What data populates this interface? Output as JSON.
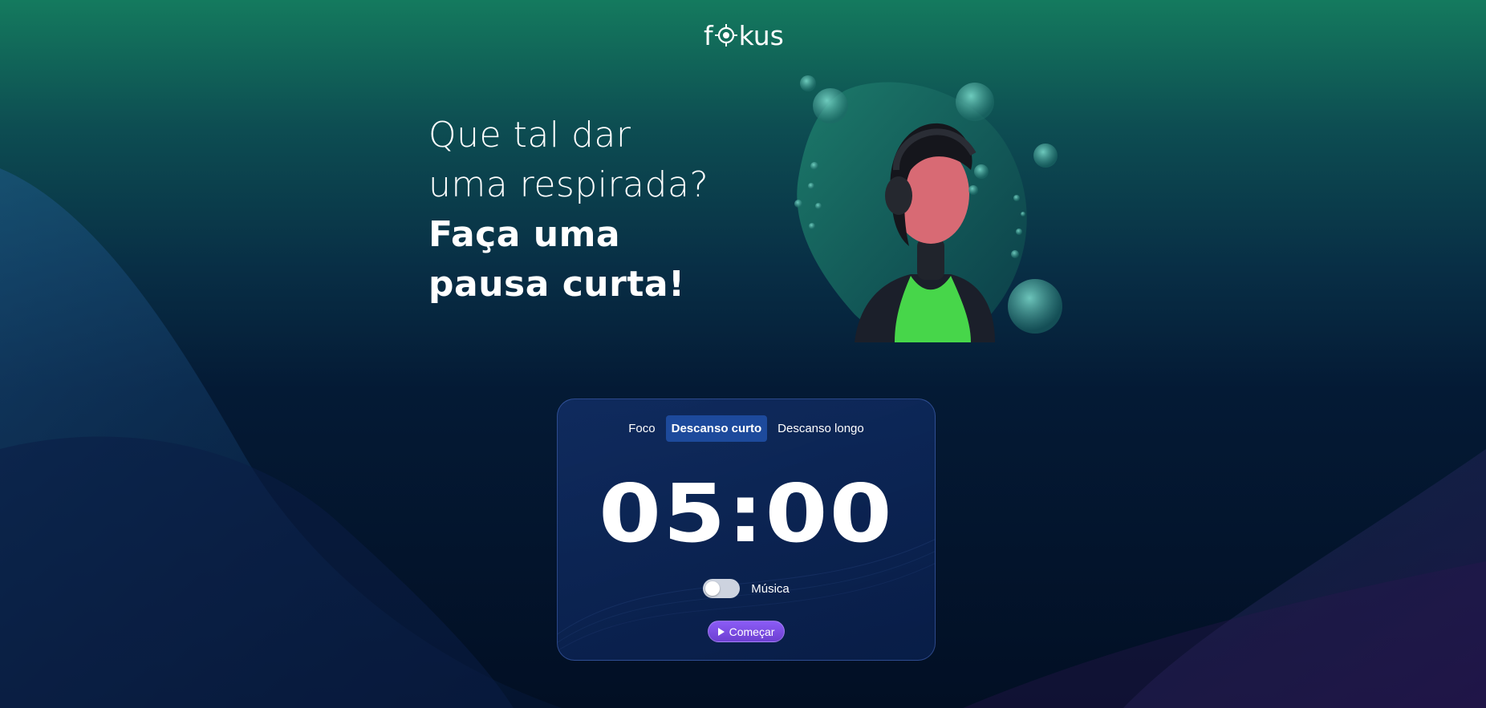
{
  "brand": {
    "logo_text_before": "f",
    "logo_text_after": "kus"
  },
  "headline": {
    "line1": "Que tal dar",
    "line2": "uma respirada?",
    "line3": "Faça uma",
    "line4": "pausa curta!"
  },
  "timer_card": {
    "tabs": [
      {
        "label": "Foco",
        "active": false
      },
      {
        "label": "Descanso curto",
        "active": true
      },
      {
        "label": "Descanso longo",
        "active": false
      }
    ],
    "time": "05:00",
    "music_label": "Música",
    "music_enabled": false,
    "start_label": "Começar"
  },
  "colors": {
    "accent_purple": "#8b5cf6",
    "active_tab": "#1d4a9c",
    "bg_top": "#147a5e",
    "bg_bottom": "#020f24"
  }
}
